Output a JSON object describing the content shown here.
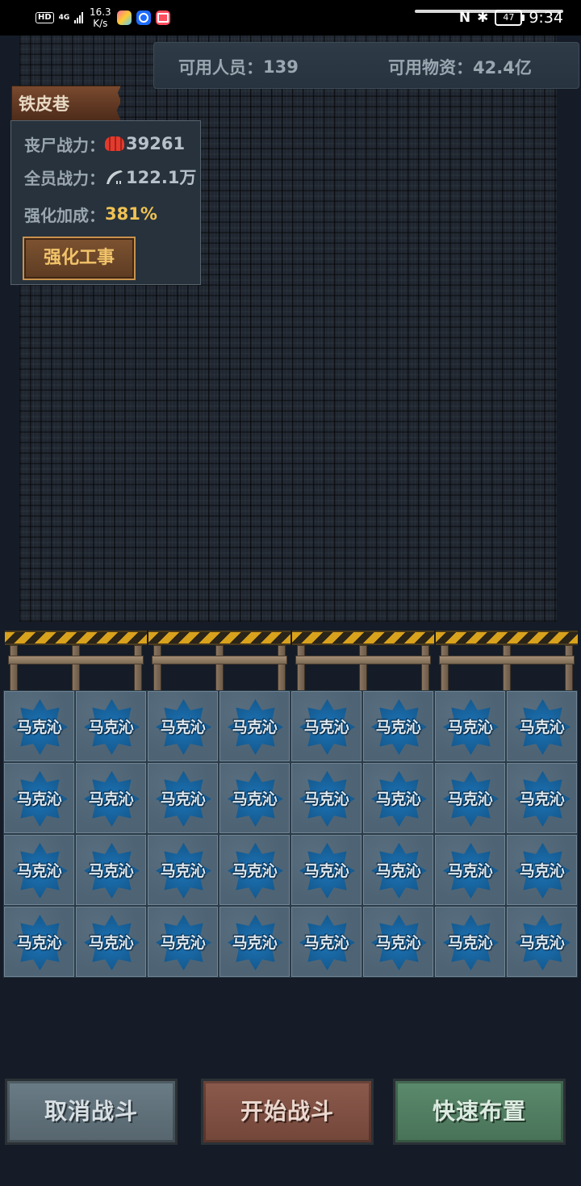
{
  "status_bar": {
    "hd": "HD",
    "network": "4G",
    "speed_value": "16.3",
    "speed_unit": "K/s",
    "nfc": "N",
    "bluetooth": "✱",
    "battery": "47",
    "time": "9:34"
  },
  "resources": {
    "people_label": "可用人员：",
    "people_value": "139",
    "goods_label": "可用物资：",
    "goods_value": "42.4亿"
  },
  "area": {
    "name": "铁皮巷"
  },
  "info": {
    "zombie_label": "丧尸战力：",
    "zombie_value": "39261",
    "power_label": "全员战力：",
    "power_value": "122.1万",
    "bonus_label": "强化加成：",
    "bonus_value": "381%",
    "enhance_button": "强化工事"
  },
  "grid": {
    "rows": 4,
    "cols": 8,
    "cells": [
      "马克沁",
      "马克沁",
      "马克沁",
      "马克沁",
      "马克沁",
      "马克沁",
      "马克沁",
      "马克沁",
      "马克沁",
      "马克沁",
      "马克沁",
      "马克沁",
      "马克沁",
      "马克沁",
      "马克沁",
      "马克沁",
      "马克沁",
      "马克沁",
      "马克沁",
      "马克沁",
      "马克沁",
      "马克沁",
      "马克沁",
      "马克沁",
      "马克沁",
      "马克沁",
      "马克沁",
      "马克沁",
      "马克沁",
      "马克沁",
      "马克沁",
      "马克沁"
    ]
  },
  "buttons": {
    "cancel": "取消战斗",
    "start": "开始战斗",
    "quick": "快速布置"
  },
  "colors": {
    "background": "#151c27",
    "gold_text": "#f0c254",
    "unit_blue": "#1d74b6"
  }
}
